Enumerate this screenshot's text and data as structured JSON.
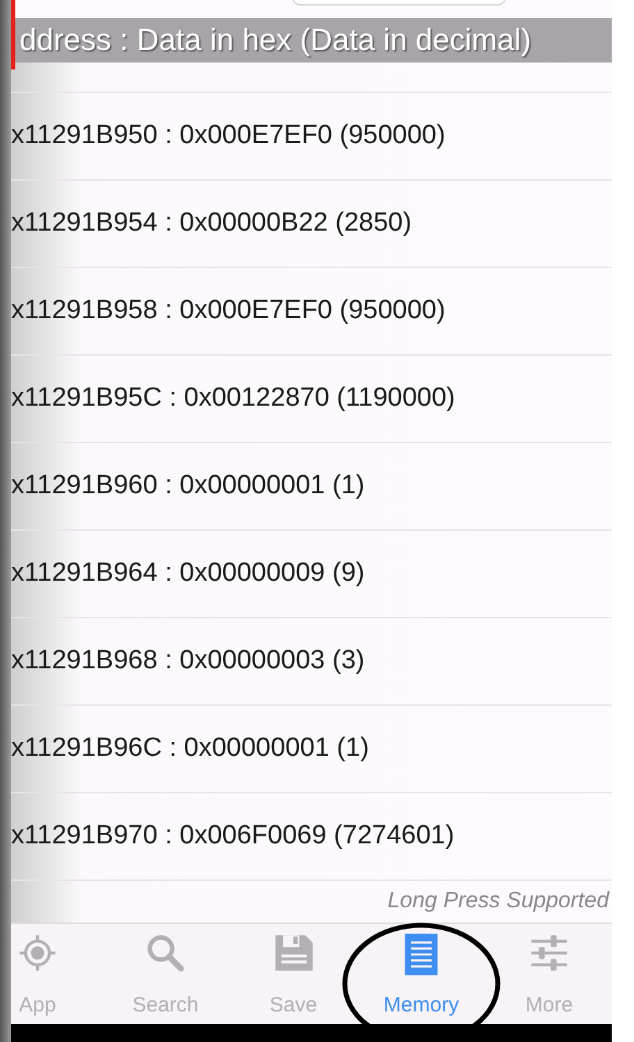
{
  "header": {
    "title": "ddress : Data in hex (Data in decimal)"
  },
  "rows": [
    {
      "text": "x11291B950 : 0x000E7EF0 (950000)"
    },
    {
      "text": "x11291B954 : 0x00000B22 (2850)"
    },
    {
      "text": "x11291B958 : 0x000E7EF0 (950000)"
    },
    {
      "text": "x11291B95C : 0x00122870 (1190000)"
    },
    {
      "text": "x11291B960 : 0x00000001 (1)"
    },
    {
      "text": "x11291B964 : 0x00000009 (9)"
    },
    {
      "text": "x11291B968 : 0x00000003 (3)"
    },
    {
      "text": "x11291B96C : 0x00000001 (1)"
    },
    {
      "text": "x11291B970 : 0x006F0069 (7274601)"
    }
  ],
  "hint": "Long Press Supported",
  "tabs": [
    {
      "kind": "app",
      "label": "App",
      "selected": false,
      "circled": false
    },
    {
      "kind": "search",
      "label": "Search",
      "selected": false,
      "circled": false
    },
    {
      "kind": "save",
      "label": "Save",
      "selected": false,
      "circled": false
    },
    {
      "kind": "memory",
      "label": "Memory",
      "selected": true,
      "circled": true
    },
    {
      "kind": "more",
      "label": "More",
      "selected": false,
      "circled": false
    }
  ]
}
